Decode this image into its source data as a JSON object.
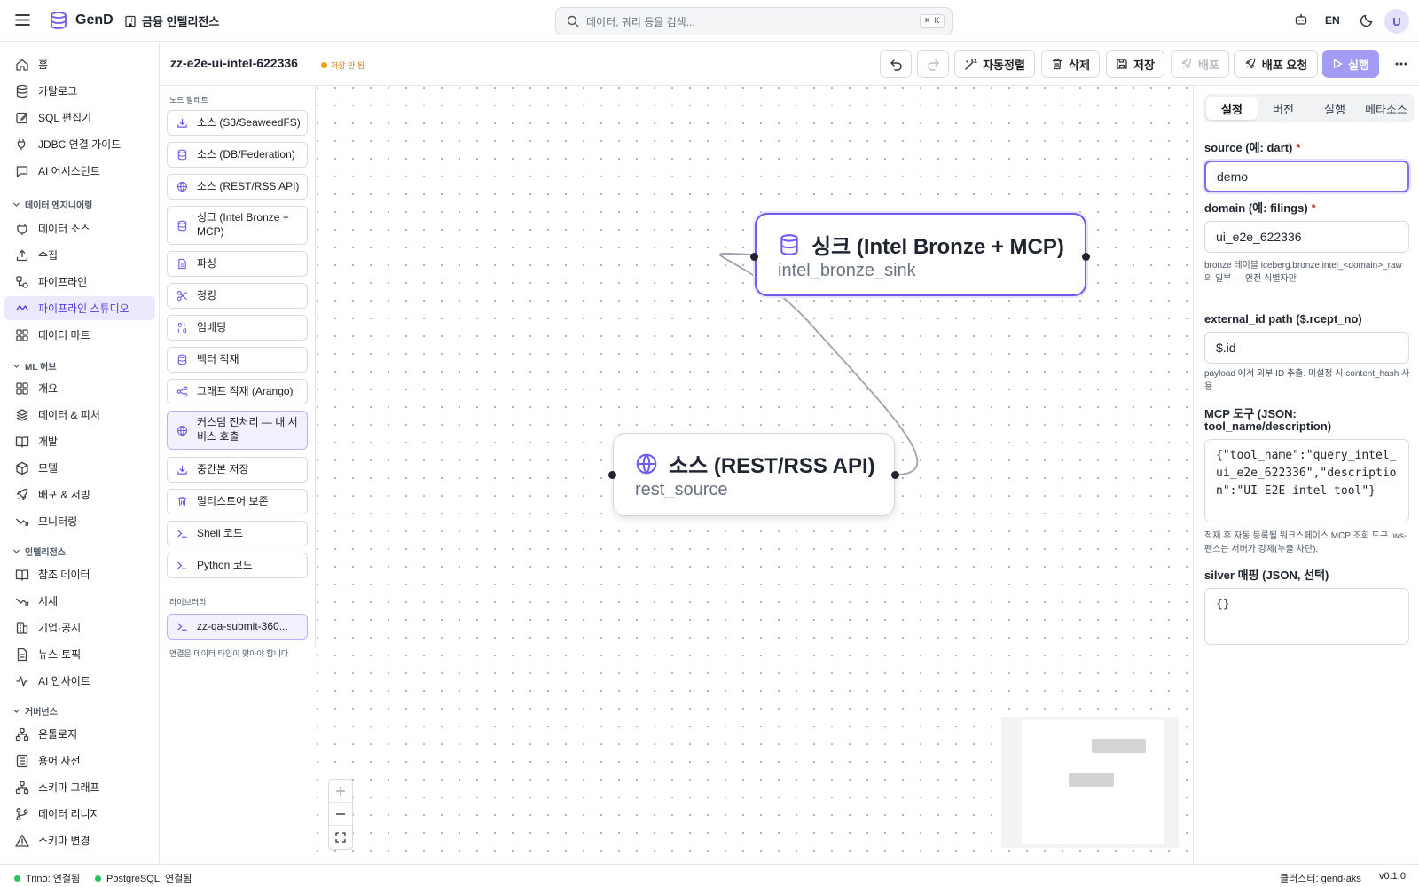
{
  "topbar": {
    "brand": "GenD",
    "workspace": "금융 인텔리전스",
    "search_placeholder": "데이터, 쿼리 등을 검색...",
    "search_shortcut": "⌘ K",
    "lang": "EN",
    "avatar": "U"
  },
  "nav": {
    "items": [
      "홈",
      "카탈로그",
      "SQL 편집기",
      "JDBC 연결 가이드",
      "AI 어시스턴트"
    ],
    "sections": [
      {
        "title": "데이터 엔지니어링",
        "items": [
          "데이터 소스",
          "수집",
          "파이프라인",
          "파이프라인 스튜디오",
          "데이터 마트"
        ]
      },
      {
        "title": "ML 허브",
        "items": [
          "개요",
          "데이터 & 피처",
          "개발",
          "모델",
          "배포 & 서빙",
          "모니터링"
        ]
      },
      {
        "title": "인텔리전스",
        "items": [
          "참조 데이터",
          "시세",
          "기업·공시",
          "뉴스·토픽",
          "AI 인사이트"
        ]
      },
      {
        "title": "거버넌스",
        "items": [
          "온톨로지",
          "용어 사전",
          "스키마 그래프",
          "데이터 리니지",
          "스키마 변경"
        ]
      }
    ]
  },
  "header": {
    "title": "zz-e2e-ui-intel-622336",
    "unsaved": "저장 안 됨",
    "buttons": {
      "autolayout": "자동정렬",
      "delete": "삭제",
      "save": "저장",
      "deploy": "배포",
      "deploy_request": "배포 요청",
      "run": "실행"
    }
  },
  "palette": {
    "title": "노드 팔레트",
    "items": [
      "소스 (S3/SeaweedFS)",
      "소스 (DB/Federation)",
      "소스 (REST/RSS API)",
      "싱크 (Intel Bronze + MCP)",
      "파싱",
      "청킹",
      "임베딩",
      "벡터 적재",
      "그래프 적재 (Arango)",
      "커스텀 전처리 — 내 서비스 호출",
      "중간본 저장",
      "멀티스토어 보존",
      "Shell 코드",
      "Python 코드"
    ],
    "library_title": "라이브러리",
    "library_items": [
      "zz-qa-submit-360..."
    ],
    "note": "연결은 데이터 타입이 맞아야 합니다"
  },
  "canvas": {
    "nodes": [
      {
        "title": "싱크 (Intel Bronze + MCP)",
        "subtitle": "intel_bronze_sink",
        "icon": "database-icon",
        "selected": true
      },
      {
        "title": "소스 (REST/RSS API)",
        "subtitle": "rest_source",
        "icon": "globe-icon",
        "selected": false
      }
    ]
  },
  "panel": {
    "tabs": [
      "설정",
      "버전",
      "실행",
      "메타소스"
    ],
    "active_tab": "설정",
    "fields": {
      "source": {
        "label": "source (예: dart)",
        "value": "demo"
      },
      "domain": {
        "label": "domain (예: filings)",
        "value": "ui_e2e_622336",
        "help": "bronze 테이블 iceberg.bronze.intel_<domain>_raw 의 일부 — 안전 식별자만"
      },
      "external_id": {
        "label": "external_id path ($.rcept_no)",
        "value": "$.id",
        "help": "payload 에서 외부 ID 추출. 미설정 시 content_hash 사용"
      },
      "mcp": {
        "label": "MCP 도구 (JSON: tool_name/description)",
        "value": "{\"tool_name\":\"query_intel_ui_e2e_622336\",\"description\":\"UI E2E intel tool\"}",
        "help": "적재 후 자동 등록될 워크스페이스 MCP 조회 도구. ws-펜스는 서버가 강제(누출 차단)."
      },
      "silver": {
        "label": "silver 매핑 (JSON, 선택)",
        "value": "{}"
      }
    }
  },
  "status": {
    "trino": "Trino: 연결됨",
    "postgres": "PostgreSQL: 연결됨",
    "cluster": "클러스터: gend-aks",
    "version": "v0.1.0"
  },
  "colors": {
    "accent": "#6d5ef0",
    "unsaved": "#f59e0b",
    "connected": "#22c55e"
  }
}
